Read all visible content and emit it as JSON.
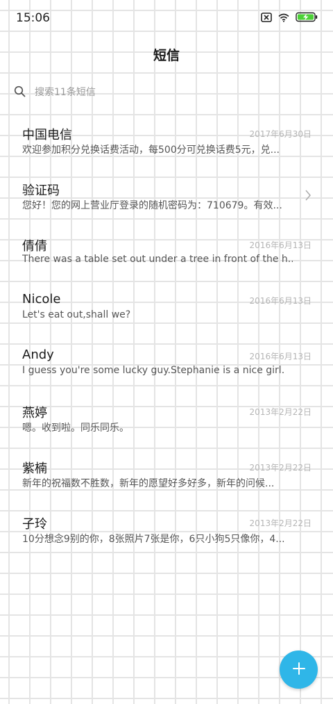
{
  "status_bar": {
    "time": "15:06",
    "icons": [
      "sim-card-x-icon",
      "wifi-icon",
      "battery-charging-icon"
    ]
  },
  "header": {
    "title": "短信"
  },
  "search": {
    "placeholder": "搜索11条短信",
    "value": "",
    "icon": "search-icon"
  },
  "messages": [
    {
      "sender": "中国电信",
      "date": "2017年6月30日",
      "preview": "欢迎参加积分兑换话费活动，每500分可兑换话费5元，兑..."
    },
    {
      "sender": "验证码",
      "date": "",
      "preview": "您好！您的网上营业厅登录的随机密码为：710679。有效...",
      "icon": "chevron-right-icon"
    },
    {
      "sender": "倩倩",
      "date": "2016年6月13日",
      "preview": "There was a table set out under a tree in front of the h..."
    },
    {
      "sender": "Nicole",
      "date": "2016年6月13日",
      "preview": "Let's eat out,shall we?"
    },
    {
      "sender": "Andy",
      "date": "2016年6月13日",
      "preview": "I guess you're some lucky guy.Stephanie is a nice girl."
    },
    {
      "sender": "燕婷",
      "date": "2013年2月22日",
      "preview": "嗯。收到啦。同乐同乐。"
    },
    {
      "sender": "紫楠",
      "date": "2013年2月22日",
      "preview": "新年的祝福数不胜数，新年的愿望好多好多，新年的问候..."
    },
    {
      "sender": "子玲",
      "date": "2013年2月22日",
      "preview": "10分想念9别的你，8张照片7张是你，6只小狗5只像你，4..."
    }
  ],
  "fab": {
    "icon": "plus-icon",
    "color": "#2fb6e8"
  },
  "colors": {
    "accent": "#2fb6e8",
    "battery": "#4cd137",
    "grid": "#e4e4e4"
  }
}
